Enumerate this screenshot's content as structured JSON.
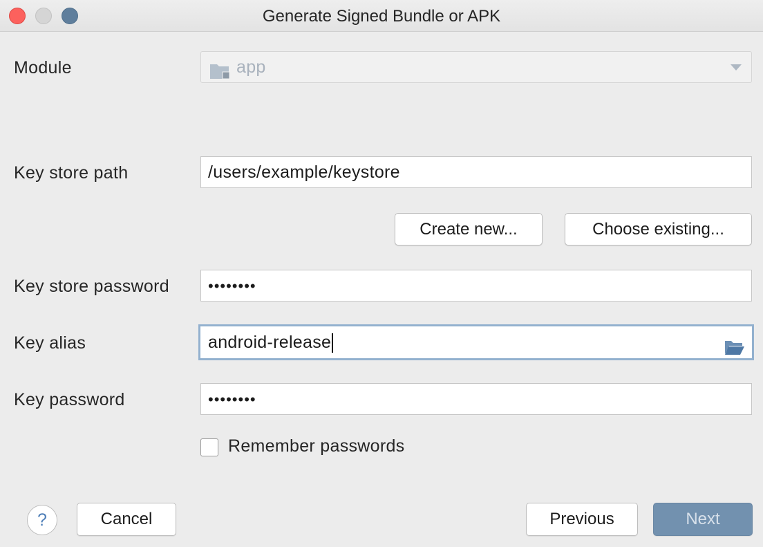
{
  "window": {
    "title": "Generate Signed Bundle or APK"
  },
  "module": {
    "label": "Module",
    "value": "app",
    "icon": "module-folder-icon"
  },
  "keystore": {
    "path_label": "Key store path",
    "path_value": "/users/example/keystore",
    "create_new_label": "Create new...",
    "choose_existing_label": "Choose existing...",
    "password_label": "Key store password",
    "password_value": "••••••••"
  },
  "key": {
    "alias_label": "Key alias",
    "alias_value": "android-release",
    "alias_icon": "open-folder-icon",
    "password_label": "Key password",
    "password_value": "••••••••"
  },
  "remember": {
    "label": "Remember passwords",
    "checked": false
  },
  "footer": {
    "help_label": "?",
    "cancel_label": "Cancel",
    "previous_label": "Previous",
    "next_label": "Next"
  },
  "colors": {
    "close": "#fc615d",
    "minimize": "#d5d5d5",
    "maximize": "#5f7e9c",
    "next_button": "#7291af",
    "focus_ring": "#93b1cf"
  }
}
